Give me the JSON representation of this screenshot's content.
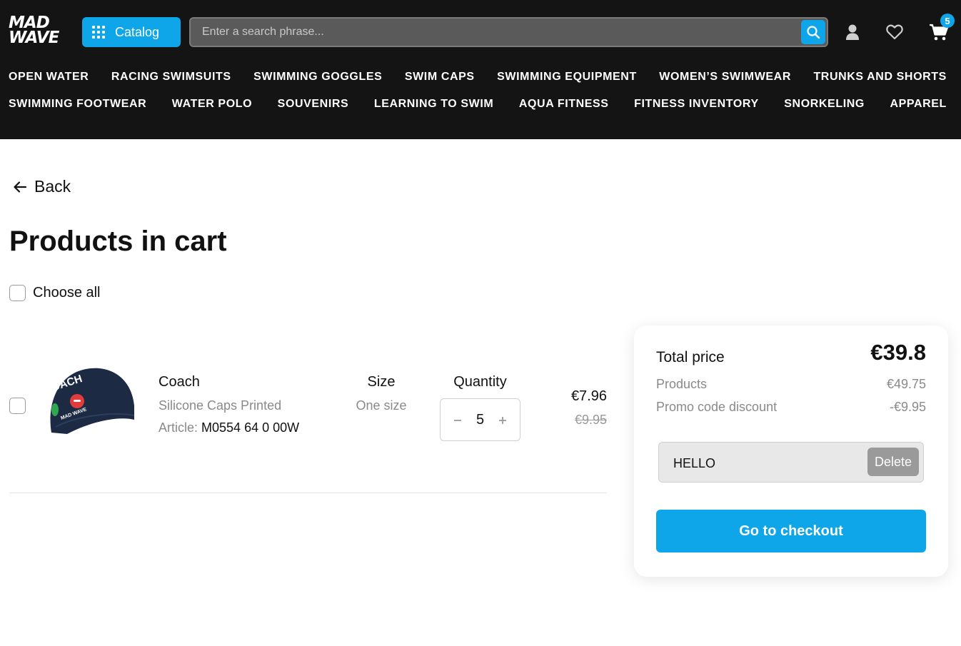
{
  "header": {
    "logo": {
      "line1": "MAD",
      "line2": "WAVE"
    },
    "catalog_label": "Catalog",
    "search": {
      "placeholder": "Enter a search phrase...",
      "value": ""
    },
    "cart_count": "5",
    "icons": [
      "search-icon",
      "user-icon",
      "heart-icon",
      "cart-icon"
    ],
    "accent_color": "#0ea5e9"
  },
  "nav": {
    "row1": [
      "OPEN WATER",
      "RACING SWIMSUITS",
      "SWIMMING GOGGLES",
      "SWIM CAPS",
      "SWIMMING EQUIPMENT",
      "WOMEN’S SWIMWEAR",
      "TRUNKS AND SHORTS"
    ],
    "row2": [
      "SWIMMING FOOTWEAR",
      "WATER POLO",
      "SOUVENIRS",
      "LEARNING TO SWIM",
      "AQUA FITNESS",
      "FITNESS INVENTORY",
      "SNORKELING",
      "APPAREL"
    ]
  },
  "page": {
    "back_label": "Back",
    "title": "Products in cart",
    "choose_all_label": "Choose all"
  },
  "cart_item": {
    "name": "Coach",
    "subtitle": "Silicone Caps Printed",
    "article_label": "Article:",
    "article_value": "M0554 64 0 00W",
    "size_label": "Size",
    "size_value": "One size",
    "quantity_label": "Quantity",
    "quantity": "5",
    "price": "€7.96",
    "old_price": "€9.95",
    "image_text": {
      "cap_text": "OACH",
      "brand_text": "MAD WAVE"
    }
  },
  "summary": {
    "total_label": "Total price",
    "total_value": "€39.8",
    "products_label": "Products",
    "products_value": "€49.75",
    "discount_label": "Promo code discount",
    "discount_value": "-€9.95",
    "promo_code": "HELLO",
    "delete_label": "Delete",
    "checkout_label": "Go to checkout"
  }
}
